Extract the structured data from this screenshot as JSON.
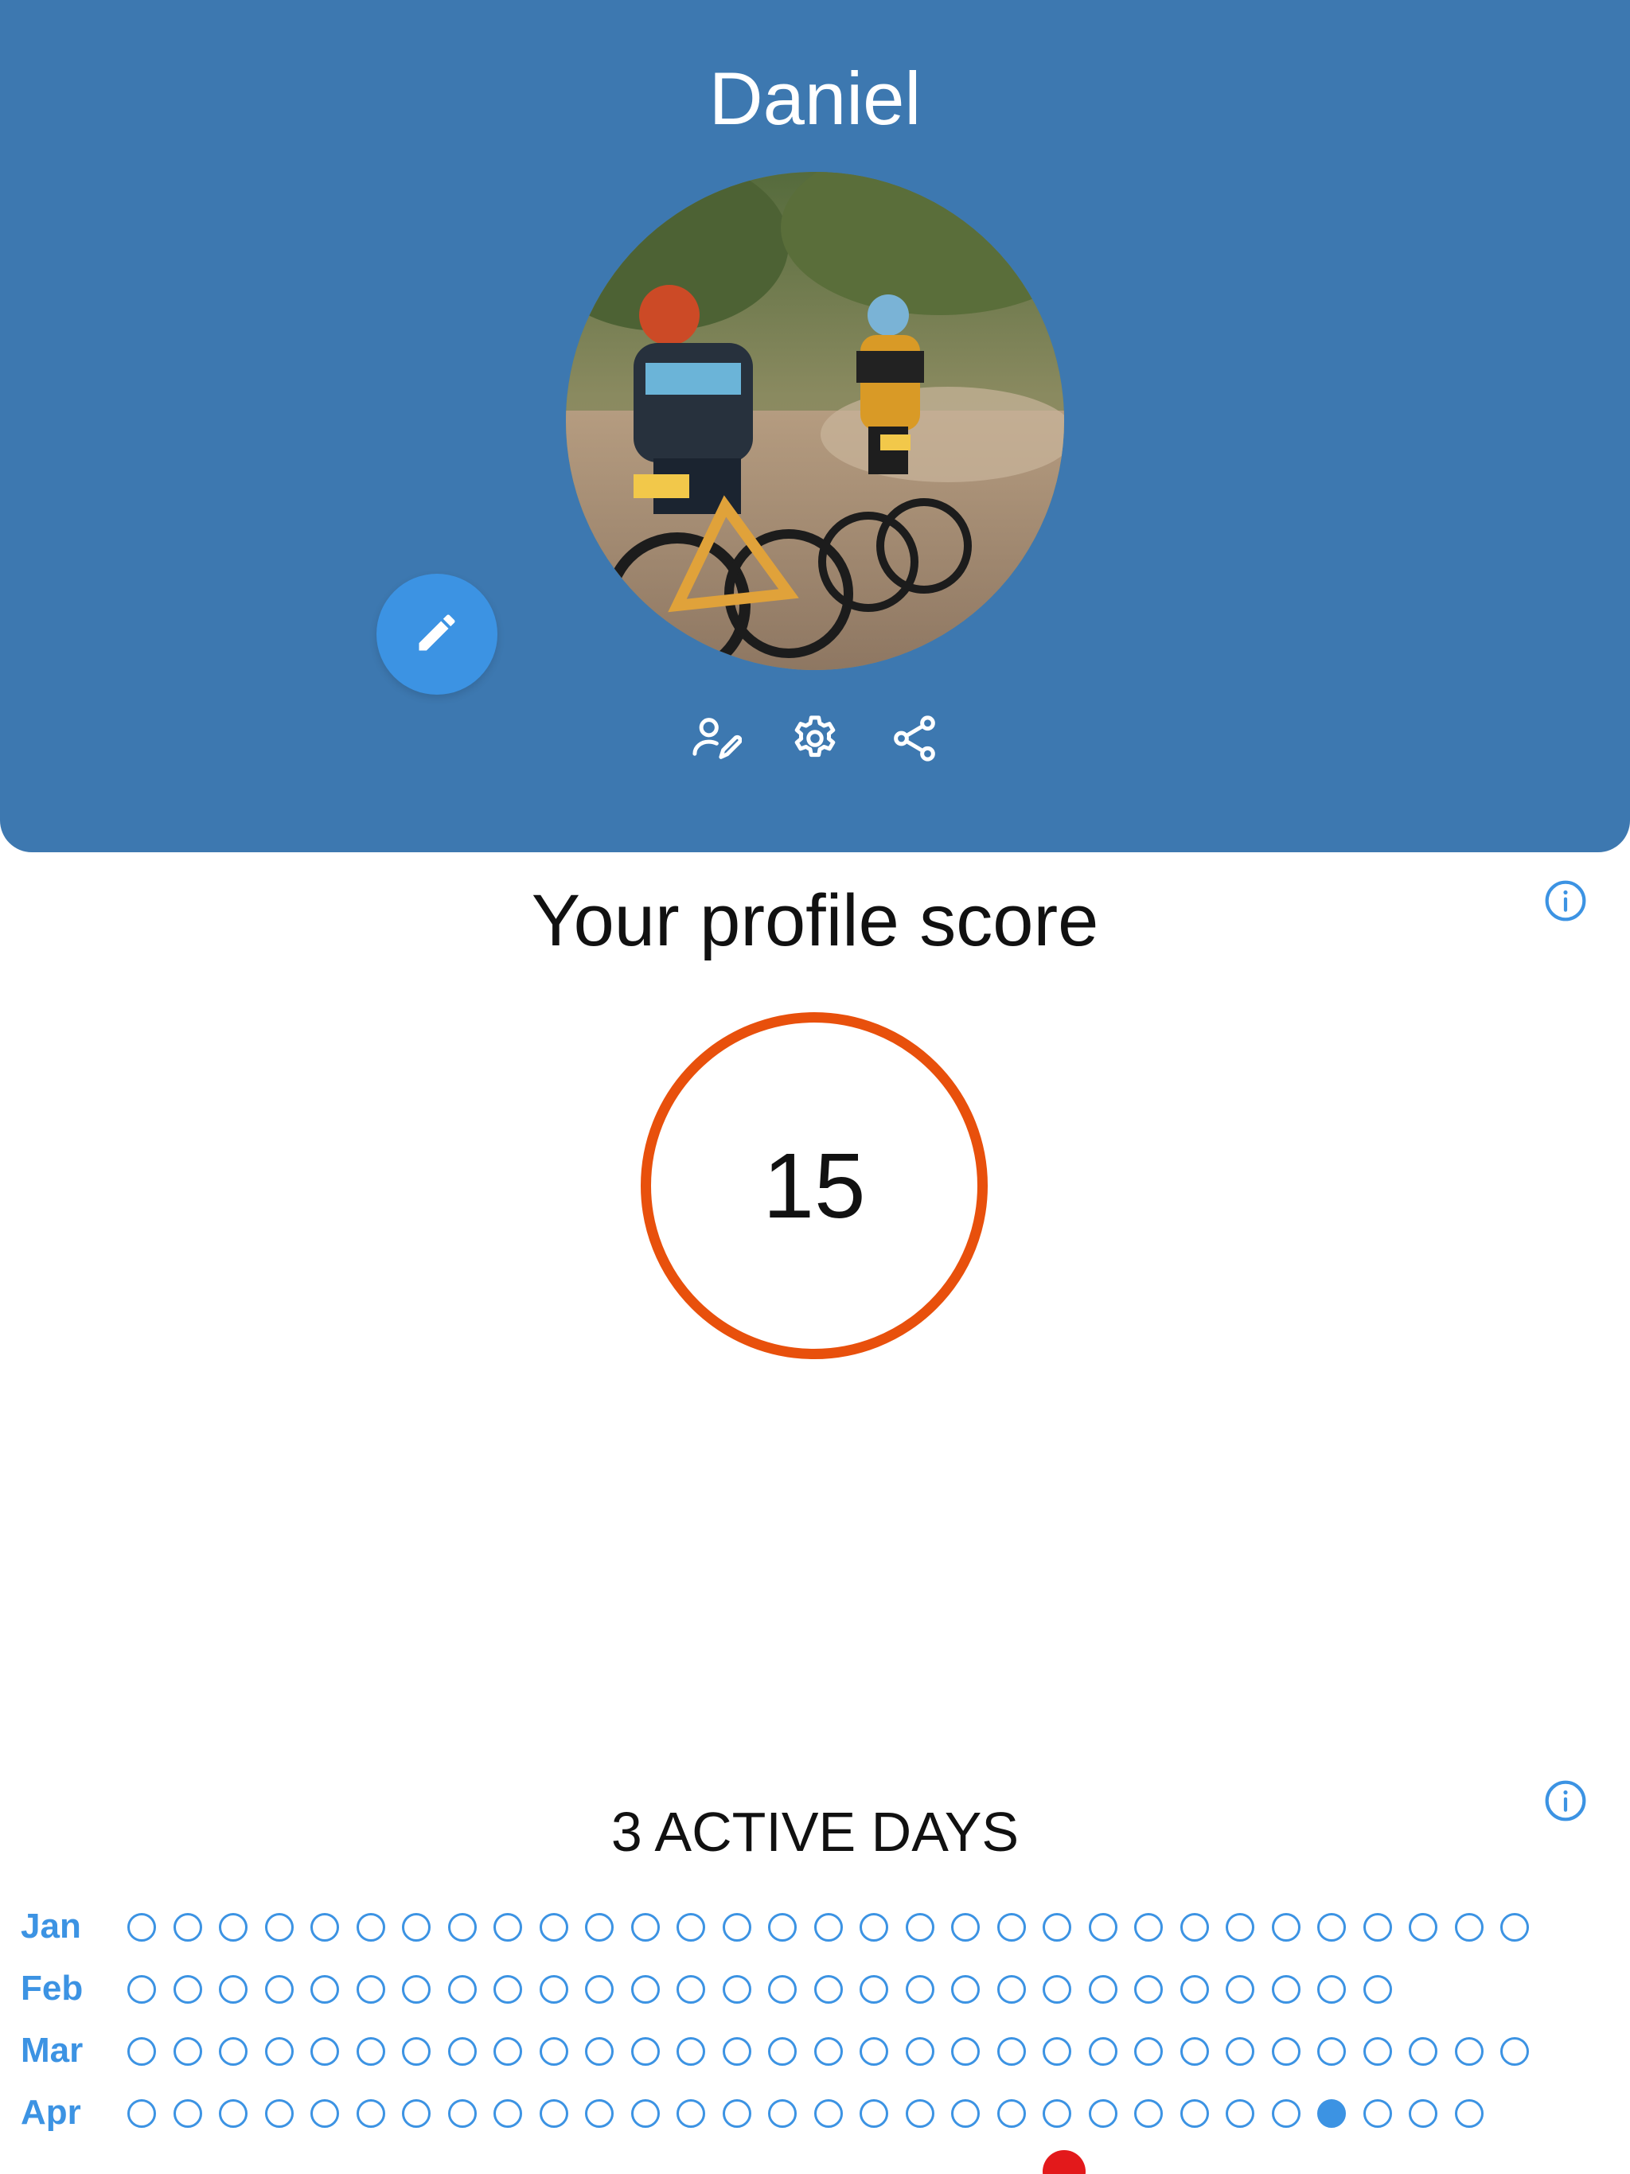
{
  "profile": {
    "name": "Daniel"
  },
  "icons": {
    "edit": "pencil-icon",
    "edit_profile": "user-edit-icon",
    "settings": "gear-icon",
    "share": "share-icon",
    "info": "info-icon"
  },
  "score": {
    "title": "Your profile score",
    "value": "15"
  },
  "activity": {
    "title": "3 ACTIVE DAYS",
    "months": [
      {
        "label": "Jan",
        "days": 31,
        "active": []
      },
      {
        "label": "Feb",
        "days": 28,
        "active": []
      },
      {
        "label": "Mar",
        "days": 31,
        "active": []
      },
      {
        "label": "Apr",
        "days": 30,
        "active": [
          27
        ]
      }
    ]
  },
  "colors": {
    "header_bg": "#3d78b0",
    "accent": "#3c93e3",
    "score_ring": "#e8500c",
    "badge": "#e3191b"
  }
}
